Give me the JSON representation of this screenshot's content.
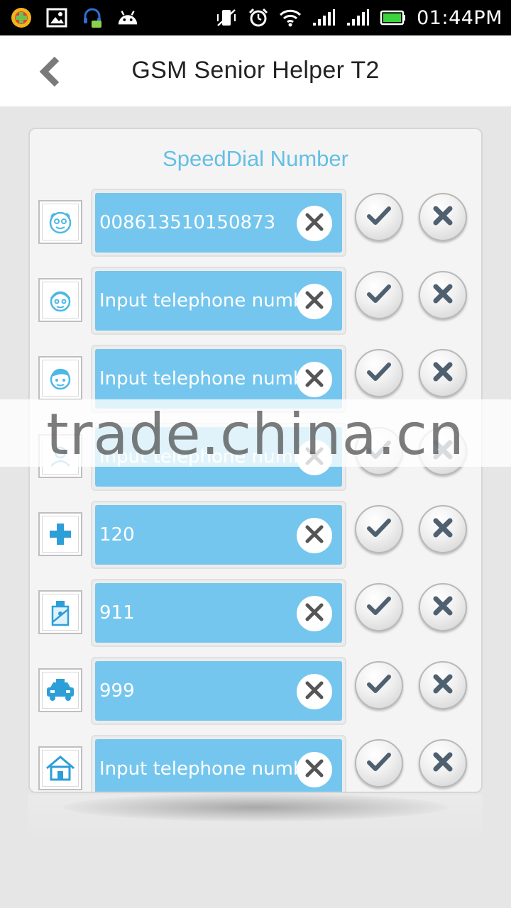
{
  "status_bar": {
    "time": "01:44PM",
    "left_icons": [
      "game-app-icon",
      "gallery-icon",
      "headset-chat-icon",
      "android-icon"
    ],
    "right_icons": [
      "vibrate-off-icon",
      "alarm-icon",
      "wifi-icon",
      "signal-icon",
      "signal-icon-2",
      "battery-icon"
    ]
  },
  "header": {
    "title": "GSM Senior Helper T2",
    "back_icon": "chevron-left-icon"
  },
  "card": {
    "title": "SpeedDial Number",
    "rows": [
      {
        "avatar": "grandpa-face-icon",
        "value": "008613510150873",
        "placeholder": "Input telephone number"
      },
      {
        "avatar": "grandma-face-icon",
        "value": "",
        "placeholder": "Input telephone number"
      },
      {
        "avatar": "boy-face-icon",
        "value": "",
        "placeholder": "Input telephone number"
      },
      {
        "avatar": "contact-icon",
        "value": "",
        "placeholder": "Input telephone number"
      },
      {
        "avatar": "medical-cross-icon",
        "value": "120",
        "placeholder": "Input telephone number"
      },
      {
        "avatar": "police-icon",
        "value": "911",
        "placeholder": "Input telephone number"
      },
      {
        "avatar": "taxi-icon",
        "value": "999",
        "placeholder": "Input telephone number"
      },
      {
        "avatar": "home-icon",
        "value": "",
        "placeholder": "Input telephone number"
      }
    ]
  },
  "watermark": "trade.china.cn",
  "colors": {
    "accent": "#64bfe4",
    "field": "#74c6ee",
    "header_bg": "#ffffff",
    "status_bg": "#000000"
  }
}
